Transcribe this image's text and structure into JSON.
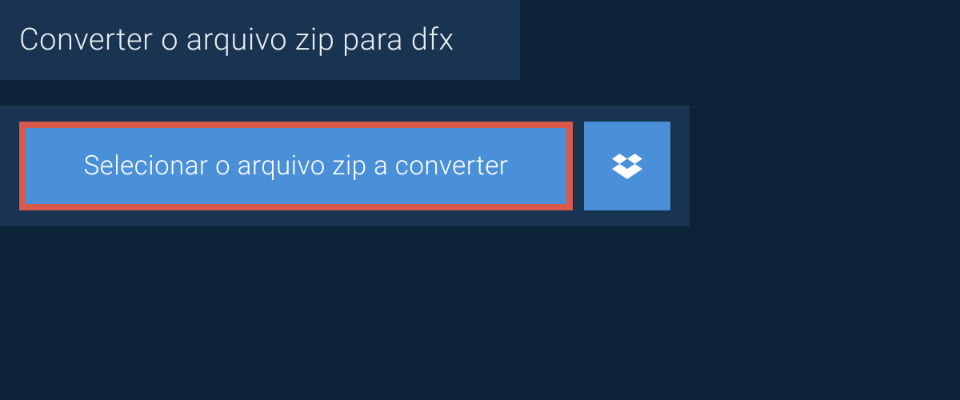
{
  "title": "Converter o arquivo zip para dfx",
  "selectButton": {
    "label": "Selecionar o arquivo zip a converter"
  },
  "dropboxButton": {
    "iconName": "dropbox-icon"
  },
  "colors": {
    "background": "#0d2438",
    "panel": "#183450",
    "primaryButton": "#4a90d9",
    "highlight": "#d9594c",
    "text": "#e8edf2"
  }
}
